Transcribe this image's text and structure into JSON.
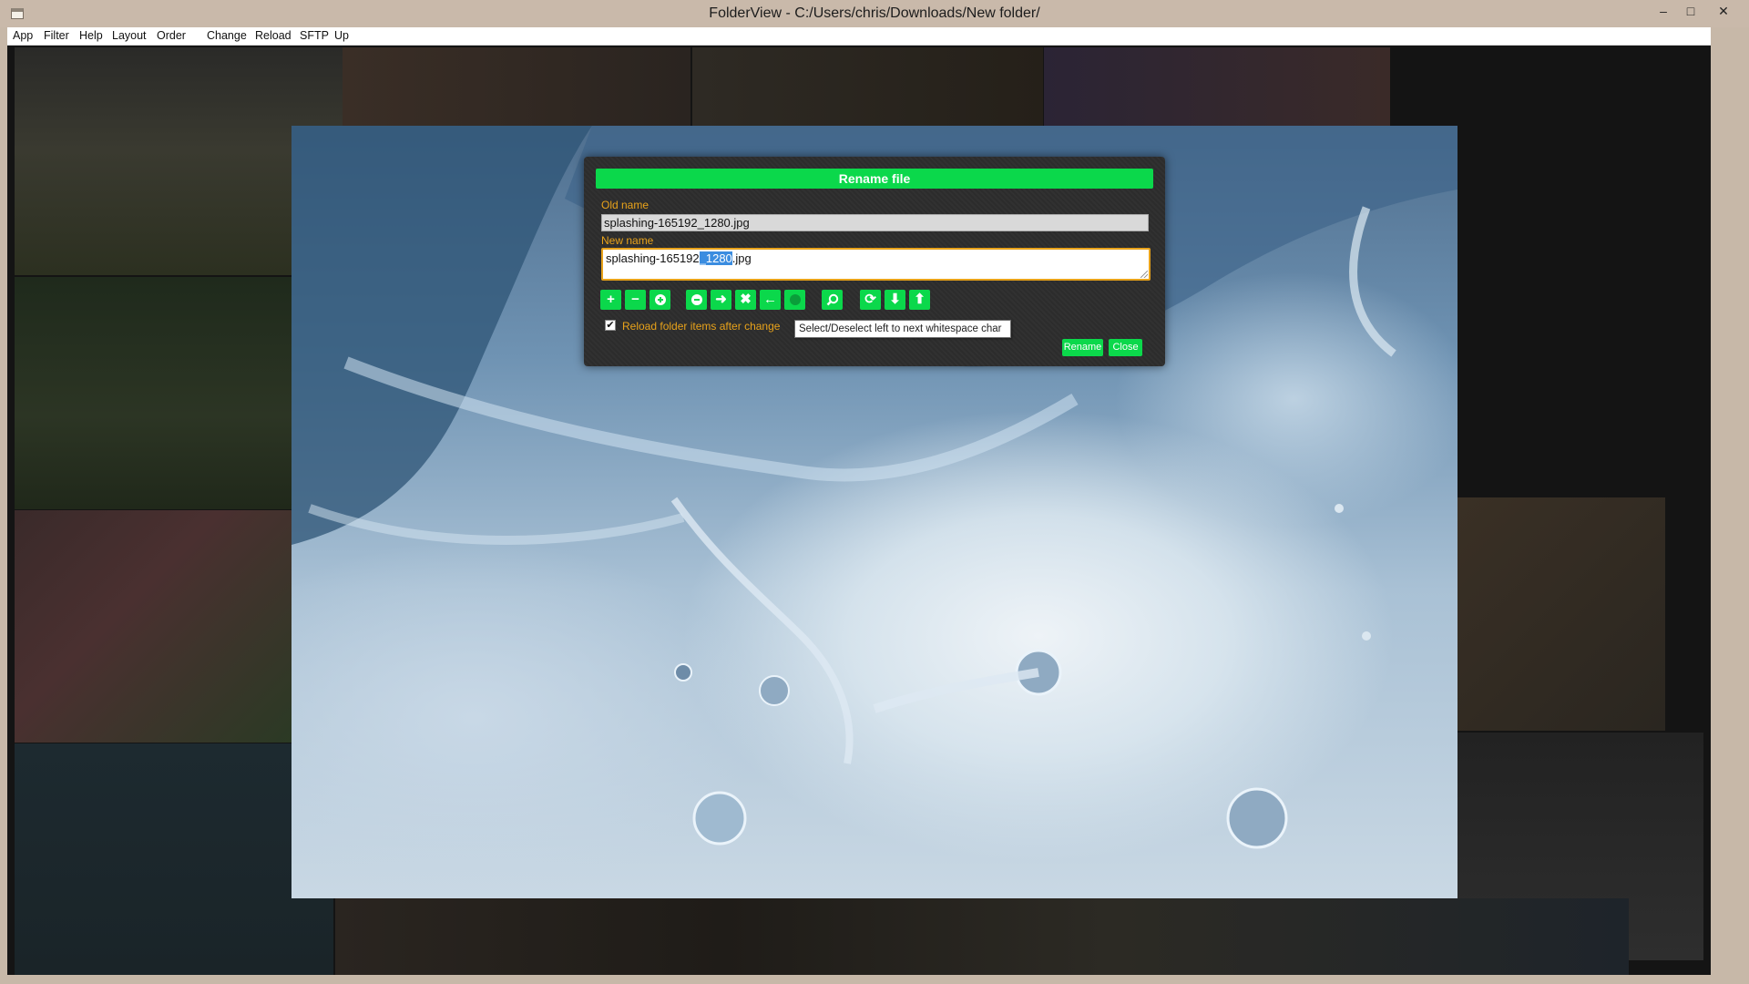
{
  "window": {
    "title": "FolderView - C:/Users/chris/Downloads/New folder/",
    "minimize_glyph": "–",
    "maximize_glyph": "□",
    "close_glyph": "✕"
  },
  "menu": {
    "items": [
      "App",
      "Filter",
      "Help",
      "Layout",
      "Order",
      "Change",
      "Reload",
      "SFTP",
      "Up"
    ]
  },
  "dialog": {
    "title": "Rename file",
    "old_name_label": "Old name",
    "old_name_value": "splashing-165192_1280.jpg",
    "new_name_label": "New name",
    "new_name_before": "splashing-165192",
    "new_name_selected": "_1280",
    "new_name_after": ".jpg",
    "reload_checked": true,
    "reload_label": "Reload folder items after change",
    "rename_button": "Rename",
    "close_button": "Close",
    "tooltip": "Select/Deselect left to next whitespace char",
    "toolbar_icons": [
      "plus-icon",
      "minus-icon",
      "circle-plus-icon",
      "circle-minus-icon",
      "arrow-right-icon",
      "x-icon",
      "arrow-left-icon",
      "circle-icon",
      "search-icon",
      "refresh-icon",
      "arrow-down-icon",
      "arrow-up-icon"
    ]
  },
  "colors": {
    "accent_green": "#0bd84b",
    "label_orange": "#e8a21a",
    "selection_blue": "#3b8de0",
    "dialog_bg": "#2e2e2e"
  }
}
